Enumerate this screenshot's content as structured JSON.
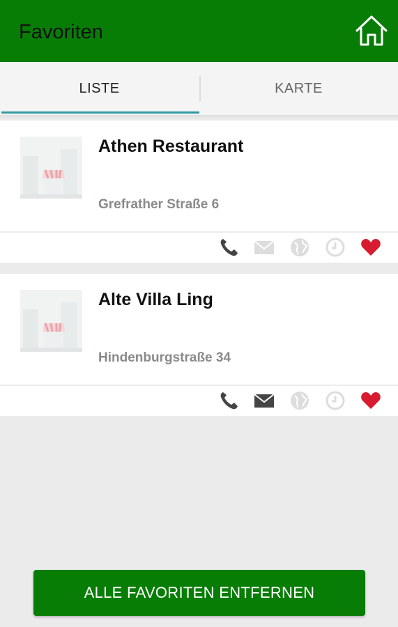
{
  "appbar": {
    "title": "Favoriten",
    "home_icon": "home-icon"
  },
  "tabs": [
    {
      "label": "LISTE",
      "active": true
    },
    {
      "label": "KARTE",
      "active": false
    }
  ],
  "favorites": [
    {
      "name": "Athen Restaurant",
      "address": "Grefrather Straße 6",
      "phone": true,
      "email": false,
      "web": false,
      "hours": false,
      "favorite": true
    },
    {
      "name": "Alte Villa Ling",
      "address": "Hindenburgstraße 34",
      "phone": true,
      "email": true,
      "web": false,
      "hours": false,
      "favorite": true
    }
  ],
  "actions": {
    "remove_all_label": "ALLE FAVORITEN ENTFERNEN"
  },
  "colors": {
    "primary": "#077d06",
    "heart": "#d81b2e",
    "icon_active": "#444444",
    "icon_inactive": "#dddddd",
    "tab_indicator": "#2f9aa0"
  }
}
